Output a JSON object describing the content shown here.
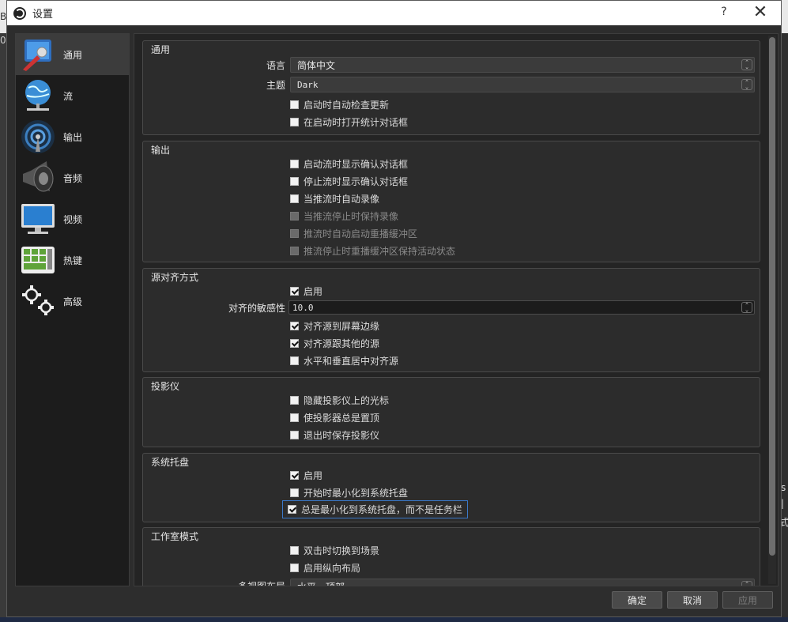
{
  "window": {
    "title": "设置",
    "help": "?",
    "close": "✕"
  },
  "background_glyphs": {
    "top_left_b": "B",
    "left_zero": "0",
    "right_1": "s",
    "right_2": "|",
    "right_3": "式"
  },
  "sidebar": {
    "items": [
      {
        "label": "通用",
        "icon": "general-icon",
        "active": true
      },
      {
        "label": "流",
        "icon": "stream-globe-icon",
        "active": false
      },
      {
        "label": "输出",
        "icon": "output-antenna-icon",
        "active": false
      },
      {
        "label": "音频",
        "icon": "audio-speaker-icon",
        "active": false
      },
      {
        "label": "视频",
        "icon": "video-monitor-icon",
        "active": false
      },
      {
        "label": "热键",
        "icon": "hotkeys-keyboard-icon",
        "active": false
      },
      {
        "label": "高级",
        "icon": "advanced-gears-icon",
        "active": false
      }
    ]
  },
  "general": {
    "title": "通用",
    "language_label": "语言",
    "language_value": "简体中文",
    "theme_label": "主题",
    "theme_value": "Dark",
    "auto_update_check": {
      "label": "启动时自动检查更新",
      "checked": false
    },
    "open_stats_on_start": {
      "label": "在启动时打开统计对话框",
      "checked": false
    }
  },
  "output": {
    "title": "输出",
    "items": [
      {
        "label": "启动流时显示确认对话框",
        "checked": false,
        "enabled": true
      },
      {
        "label": "停止流时显示确认对话框",
        "checked": false,
        "enabled": true
      },
      {
        "label": "当推流时自动录像",
        "checked": false,
        "enabled": true
      },
      {
        "label": "当推流停止时保持录像",
        "checked": false,
        "enabled": false
      },
      {
        "label": "推流时自动启动重播缓冲区",
        "checked": false,
        "enabled": false
      },
      {
        "label": "推流停止时重播缓冲区保持活动状态",
        "checked": false,
        "enabled": false
      }
    ]
  },
  "snapping": {
    "title": "源对齐方式",
    "enable": {
      "label": "启用",
      "checked": true
    },
    "sensitivity_label": "对齐的敏感性",
    "sensitivity_value": "10.0",
    "snap_screen": {
      "label": "对齐源到屏幕边缘",
      "checked": true
    },
    "snap_sources": {
      "label": "对齐源跟其他的源",
      "checked": true
    },
    "snap_center": {
      "label": "水平和垂直居中对齐源",
      "checked": false
    }
  },
  "projectors": {
    "title": "投影仪",
    "items": [
      {
        "label": "隐藏投影仪上的光标",
        "checked": false
      },
      {
        "label": "使投影器总是置顶",
        "checked": false
      },
      {
        "label": "退出时保存投影仪",
        "checked": false
      }
    ]
  },
  "tray": {
    "title": "系统托盘",
    "items": [
      {
        "label": "启用",
        "checked": true
      },
      {
        "label": "开始时最小化到系统托盘",
        "checked": false
      },
      {
        "label": "总是最小化到系统托盘，而不是任务栏",
        "checked": true
      }
    ]
  },
  "studio_mode": {
    "title": "工作室模式",
    "items": [
      {
        "label": "双击时切换到场景",
        "checked": false
      },
      {
        "label": "启用纵向布局",
        "checked": false
      }
    ],
    "multiview_label": "多视图布局",
    "multiview_value": "水平，顶部"
  },
  "buttons": {
    "ok": "确定",
    "cancel": "取消",
    "apply": "应用"
  }
}
